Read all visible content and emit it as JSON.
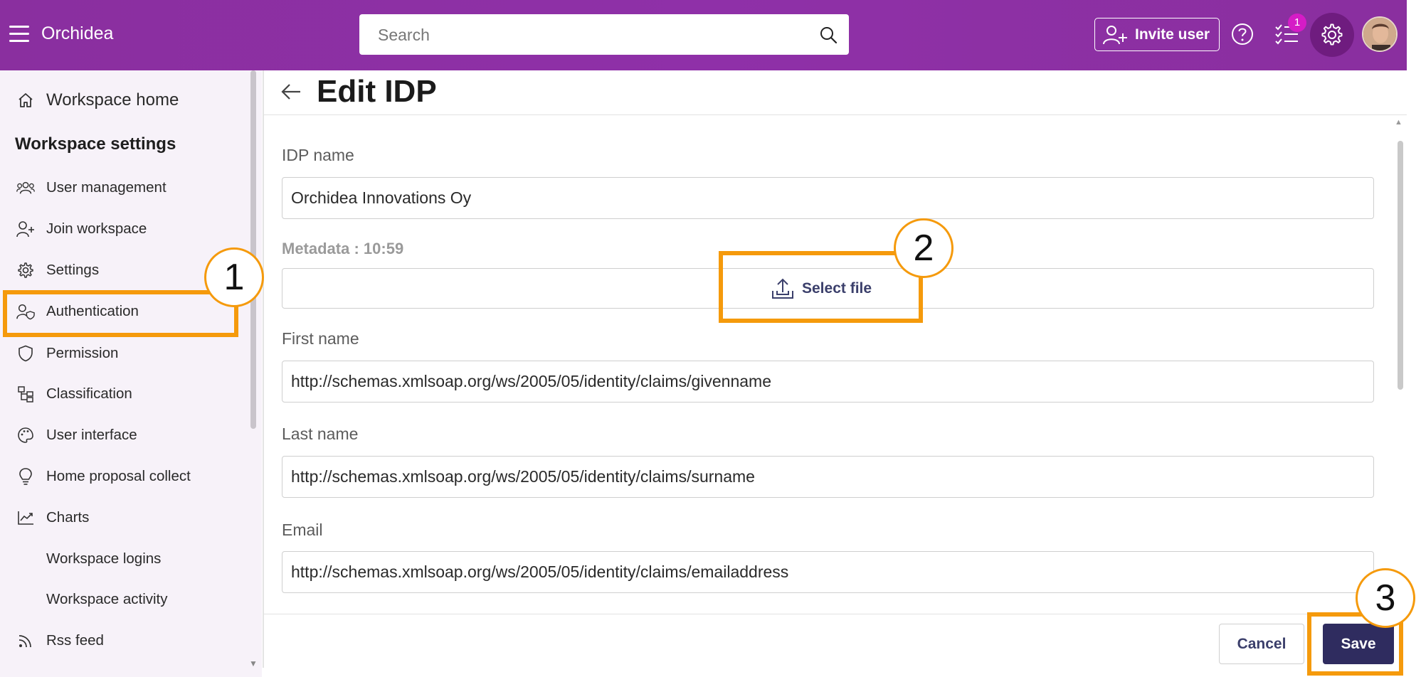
{
  "topbar": {
    "app_name": "Orchidea",
    "search_placeholder": "Search",
    "invite_label": "Invite user",
    "task_badge": "1"
  },
  "sidebar": {
    "home_label": "Workspace home",
    "section_title": "Workspace settings",
    "items": [
      {
        "label": "User management",
        "icon": "users-icon"
      },
      {
        "label": "Join workspace",
        "icon": "person-add-icon"
      },
      {
        "label": "Settings",
        "icon": "gear-icon"
      },
      {
        "label": "Authentication",
        "icon": "user-shield-icon"
      },
      {
        "label": "Permission",
        "icon": "shield-icon"
      },
      {
        "label": "Classification",
        "icon": "hierarchy-icon"
      },
      {
        "label": "User interface",
        "icon": "palette-icon"
      },
      {
        "label": "Home proposal collect",
        "icon": "lightbulb-icon"
      },
      {
        "label": "Charts",
        "icon": "chart-line-icon"
      },
      {
        "label": "Workspace logins",
        "icon": ""
      },
      {
        "label": "Workspace activity",
        "icon": ""
      },
      {
        "label": "Rss feed",
        "icon": "rss-icon"
      }
    ]
  },
  "page": {
    "title": "Edit IDP"
  },
  "form": {
    "idp_name_label": "IDP name",
    "idp_name_value": "Orchidea Innovations Oy",
    "metadata_label": "Metadata : 10:59",
    "select_file_label": "Select file",
    "first_name_label": "First name",
    "first_name_value": "http://schemas.xmlsoap.org/ws/2005/05/identity/claims/givenname",
    "last_name_label": "Last name",
    "last_name_value": "http://schemas.xmlsoap.org/ws/2005/05/identity/claims/surname",
    "email_label": "Email",
    "email_value": "http://schemas.xmlsoap.org/ws/2005/05/identity/claims/emailaddress"
  },
  "actions": {
    "cancel_label": "Cancel",
    "save_label": "Save"
  },
  "annotations": {
    "step1": "1",
    "step2": "2",
    "step3": "3",
    "highlight_color": "#f59a0c"
  },
  "colors": {
    "topbar": "#8b2fa1",
    "primary_button": "#2f2c5f",
    "sidebar_bg": "#f7f2f9"
  }
}
